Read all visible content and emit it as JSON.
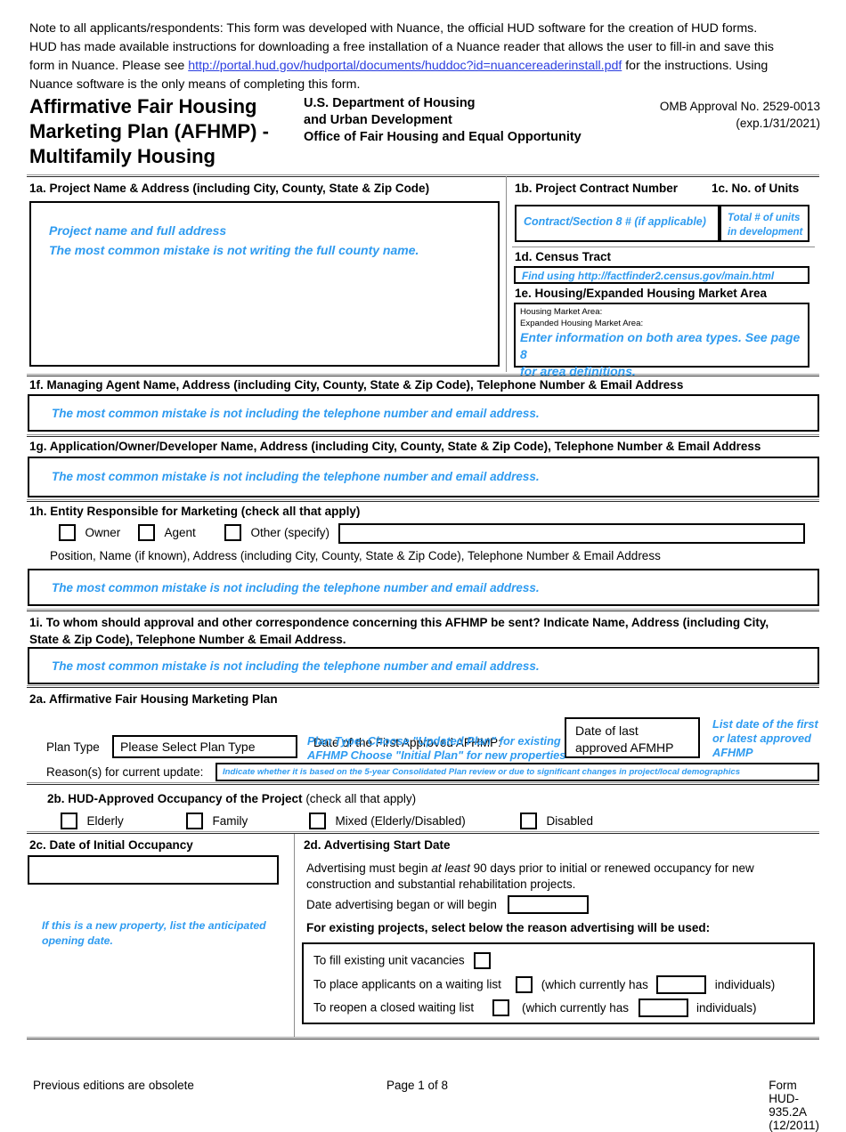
{
  "note": {
    "line1": "Note to all applicants/respondents: This form was developed with Nuance, the official HUD software for the creation of HUD forms.",
    "line2a": "HUD has made available instructions for downloading a free installation of a Nuance reader that allows the user to fill-in and save this",
    "line2b": "form in Nuance. Please see ",
    "link": "http://portal.hud.gov/hudportal/documents/huddoc?id=nuancereaderinstall.pdf",
    "line3a": " for the instructions. Using",
    "line3b": "Nuance software is the only means of completing this form."
  },
  "header": {
    "title_line1": "Affirmative Fair Housing",
    "title_line2": "Marketing Plan (AFHMP) -",
    "title_line3": "Multifamily Housing",
    "dept_line1": "U.S. Department of Housing",
    "dept_line2": "and Urban Development",
    "dept_line3": "Office of Fair Housing and Equal Opportunity",
    "omb_line1": "OMB Approval No. 2529-0013",
    "omb_line2": "(exp.1/31/2021)"
  },
  "s1a": {
    "label": "1a. Project Name & Address (including City, County, State & Zip Code)",
    "hint_line1": "Project name and full address",
    "hint_line2": "The most common mistake is not writing the full county name.",
    "value": ""
  },
  "s1b": {
    "label": "1b. Project Contract Number",
    "hint": "Contract/Section 8 # (if applicable)",
    "value": ""
  },
  "s1c": {
    "label": "1c. No. of Units",
    "hint_line1": "Total # of units",
    "hint_line2": "in development",
    "value": ""
  },
  "s1d": {
    "label": "1d. Census Tract",
    "hint": "Find using http://factfinder2.census.gov/main.html",
    "value": ""
  },
  "s1e": {
    "label": "1e. Housing/Expanded Housing Market Area",
    "sub1": "Housing Market Area:",
    "sub2": "Expanded Housing Market Area:",
    "hint_line1": "Enter information on both area types. See page 8",
    "hint_line2": "for area definitions.",
    "value": ""
  },
  "s1f": {
    "label": "1f. Managing Agent Name, Address (including City, County, State & Zip Code), Telephone Number & Email Address",
    "hint": "The most common mistake is not including the telephone number and email address.",
    "value": ""
  },
  "s1g": {
    "label": "1g. Application/Owner/Developer Name, Address (including City, County, State & Zip Code), Telephone Number & Email Address",
    "hint": "The most common mistake is not including the telephone number and email address.",
    "value": ""
  },
  "s1h": {
    "label": "1h. Entity Responsible for Marketing (check all that apply)",
    "opt_owner": "Owner",
    "opt_agent": "Agent",
    "opt_other": "Other (specify)",
    "other_value": "",
    "sublabel": "Position, Name (if known), Address (including City, County, State & Zip Code), Telephone Number & Email Address",
    "hint": "The most common mistake is not including the telephone number and email address.",
    "value": ""
  },
  "s1i": {
    "label_line1": "1i. To whom should approval and other correspondence concerning this AFHMP be sent? Indicate Name, Address (including City,",
    "label_line2": "State & Zip Code), Telephone Number & Email Address.",
    "hint": "The most common mistake is not including the telephone number and email address.",
    "value": ""
  },
  "s2a": {
    "label": "2a. Affirmative Fair Housing Marketing Plan",
    "plan_type_label": "Plan Type",
    "plan_type_value": "Please Select Plan Type",
    "date_first_label": "Date of the First Approved AFHMP:",
    "date_first_value": "",
    "plan_hint_line1": "Plan Type: Choose \"Updated Plan\" for existing",
    "plan_hint_line2": "AFHMP Choose \"Initial Plan\" for new properties",
    "date_last_line1": "Date of last",
    "date_last_line2": "approved AFMHP",
    "date_last_hint_line1": "List date of the first",
    "date_last_hint_line2": "or latest approved",
    "date_last_hint_line3": "AFHMP",
    "reason_label": "Reason(s) for current update:",
    "reason_hint": "Indicate whether it is based on the 5-year Consolidated Plan review or due to significant changes in project/local demographics",
    "reason_value": ""
  },
  "s2b": {
    "label_bold": "2b. HUD-Approved Occupancy of the Project",
    "label_norm": "(check all that apply)",
    "opt_elderly": "Elderly",
    "opt_family": "Family",
    "opt_mixed": "Mixed (Elderly/Disabled)",
    "opt_disabled": "Disabled"
  },
  "s2c": {
    "label": "2c. Date of Initial Occupancy",
    "value": "",
    "hint_line1": "If this is a new property, list the anticipated",
    "hint_line2": "opening date."
  },
  "s2d": {
    "label": "2d. Advertising Start Date",
    "body_line1a": "Advertising must begin ",
    "body_line1b": "at least",
    "body_line1c": " 90 days prior to initial or renewed occupancy for new",
    "body_line2": "construction and substantial rehabilitation projects.",
    "date_began_label": "Date advertising began or will begin",
    "date_began_value": "",
    "existing_label": "For existing projects, select below the reason advertising will be used:",
    "reasons": [
      {
        "pre": "To fill existing unit vacancies",
        "mid": "",
        "count": "",
        "post": ""
      },
      {
        "pre": "To place applicants on a waiting list",
        "mid": "(which currently has",
        "count": "",
        "post": "individuals)"
      },
      {
        "pre": "To reopen a closed waiting list",
        "mid": "(which currently has",
        "count": "",
        "post": "individuals)"
      }
    ]
  },
  "footer": {
    "left": "Previous editions are obsolete",
    "center": "Page 1 of 8",
    "right": "Form HUD-935.2A (12/2011)"
  }
}
